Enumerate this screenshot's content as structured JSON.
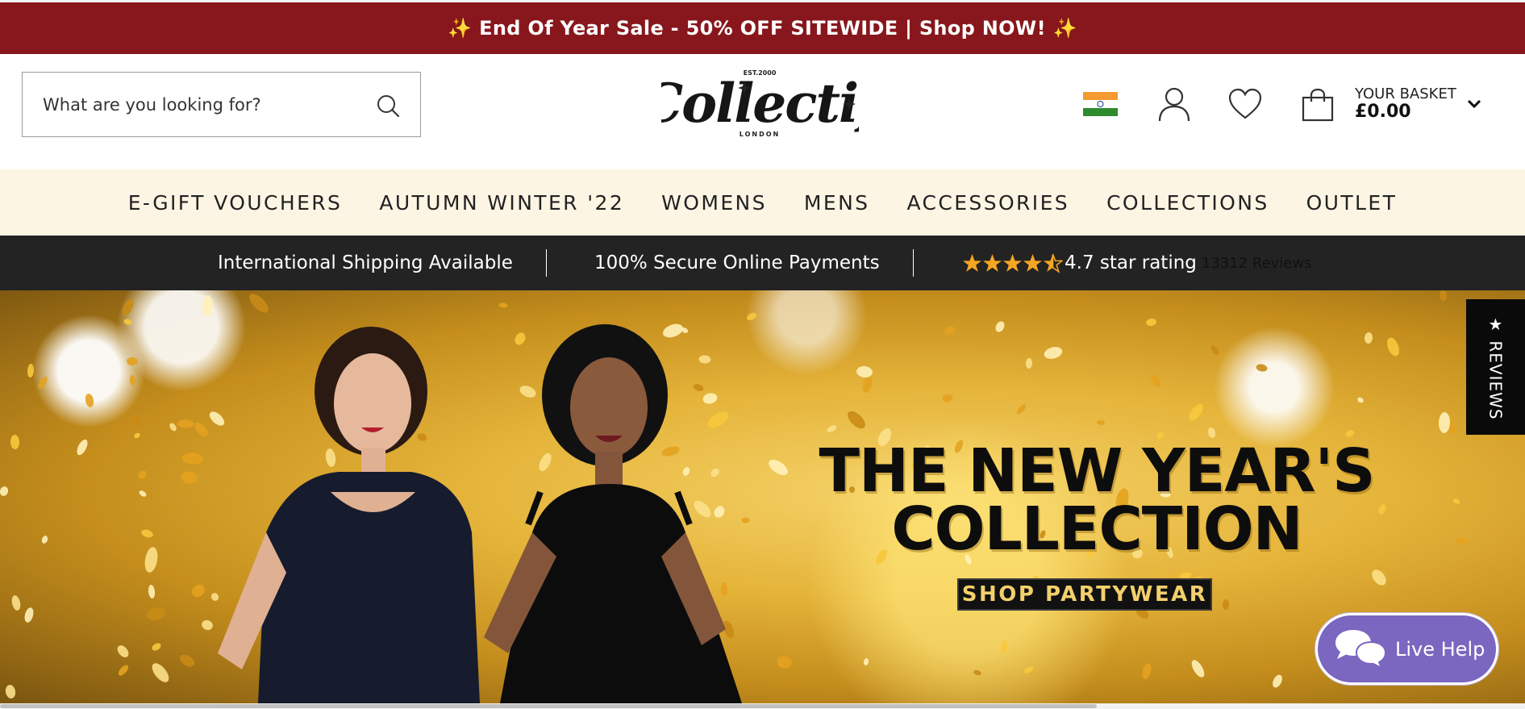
{
  "promo_banner": {
    "text": "✨ End Of Year Sale - 50% OFF SITEWIDE | Shop NOW! ✨"
  },
  "search": {
    "placeholder": "What are you looking for?"
  },
  "logo": {
    "name": "Collectif",
    "established": "EST.2000",
    "city": "LONDON"
  },
  "header": {
    "country_flag": "india-flag-icon",
    "basket": {
      "label": "YOUR BASKET",
      "total": "£0.00"
    }
  },
  "nav": {
    "items": [
      {
        "label": "E-GIFT VOUCHERS"
      },
      {
        "label": "AUTUMN WINTER '22"
      },
      {
        "label": "WOMENS"
      },
      {
        "label": "MENS"
      },
      {
        "label": "ACCESSORIES"
      },
      {
        "label": "COLLECTIONS"
      },
      {
        "label": "OUTLET"
      }
    ]
  },
  "usp": {
    "shipping": "International Shipping Available",
    "payments": "100% Secure Online Payments",
    "rating_text": "4.7 star rating",
    "rating_value": 4.7,
    "reviews": "13312 Reviews"
  },
  "hero": {
    "title_line1": "THE NEW YEAR'S",
    "title_line2": "COLLECTION",
    "cta": "SHOP PARTYWEAR"
  },
  "reviews_tab": {
    "label": "★ REVIEWS"
  },
  "live_help": {
    "label": "Live Help"
  },
  "colors": {
    "promo_bg": "#87171c",
    "nav_bg": "#fdf5e4",
    "usp_bg": "#232323",
    "star": "#f4a623",
    "live_help_bg": "#7b66c0"
  }
}
